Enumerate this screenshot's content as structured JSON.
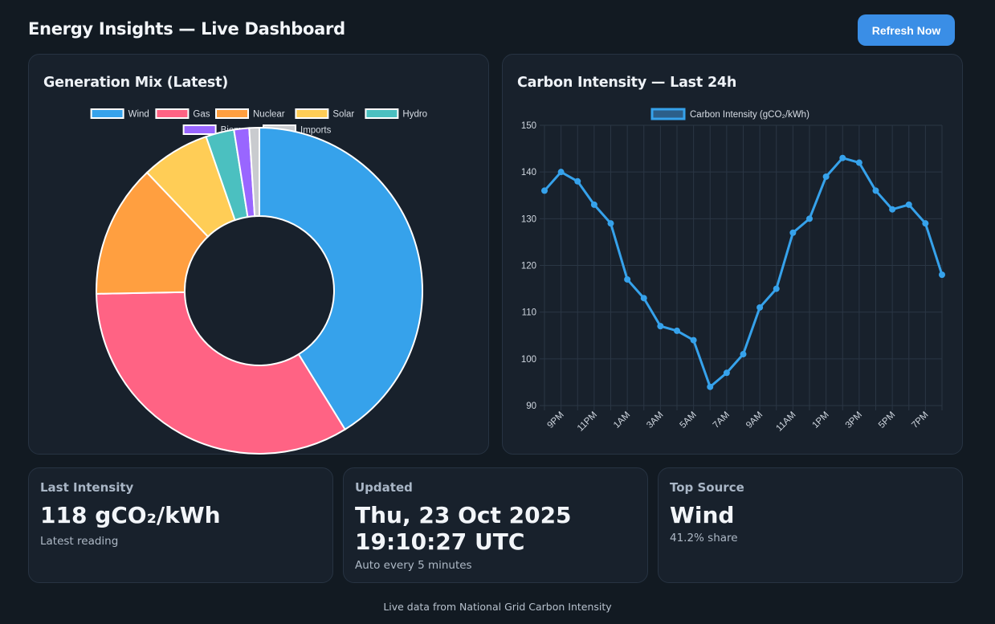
{
  "header": {
    "title": "Energy Insights — Live Dashboard",
    "refresh_label": "Refresh Now"
  },
  "generation_mix": {
    "title": "Generation Mix (Latest)"
  },
  "carbon_intensity": {
    "title": "Carbon Intensity — Last 24h"
  },
  "stats": {
    "last_intensity": {
      "label": "Last Intensity",
      "value": "118 gCO₂/kWh",
      "sub": "Latest reading"
    },
    "updated": {
      "label": "Updated",
      "value_line1": "Thu, 23 Oct 2025",
      "value_line2": "19:10:27 UTC",
      "sub": "Auto every 5 minutes"
    },
    "top_source": {
      "label": "Top Source",
      "value": "Wind",
      "sub": "41.2% share"
    }
  },
  "footer": {
    "text": "Live data from National Grid Carbon Intensity"
  },
  "colors": {
    "accent": "#3a8ee6",
    "line": "#36a2eb",
    "background": "#121a22",
    "card": "#18212c"
  },
  "chart_data": [
    {
      "type": "pie",
      "variant": "doughnut",
      "legend_position": "top",
      "categories": [
        "Wind",
        "Gas",
        "Nuclear",
        "Solar",
        "Hydro",
        "Biomass",
        "Imports"
      ],
      "values": [
        41.2,
        33.5,
        13.2,
        6.8,
        2.8,
        1.5,
        1.0
      ],
      "colors": [
        "#36a2eb",
        "#ff6384",
        "#ff9f40",
        "#ffcd56",
        "#4bc0c0",
        "#9966ff",
        "#c9cbcf"
      ]
    },
    {
      "type": "line",
      "legend_position": "top",
      "grid": true,
      "x": [
        "8PM",
        "9PM",
        "10PM",
        "11PM",
        "12AM",
        "1AM",
        "2AM",
        "3AM",
        "4AM",
        "5AM",
        "6AM",
        "7AM",
        "8AM",
        "9AM",
        "10AM",
        "11AM",
        "12PM",
        "1PM",
        "2PM",
        "3PM",
        "4PM",
        "5PM",
        "6PM",
        "7PM",
        "8PM"
      ],
      "x_tick_labels": [
        "9PM",
        "11PM",
        "1AM",
        "3AM",
        "5AM",
        "7AM",
        "9AM",
        "11AM",
        "1PM",
        "3PM",
        "5PM",
        "7PM"
      ],
      "series": [
        {
          "name": "Carbon Intensity (gCO₂/kWh)",
          "values": [
            136,
            140,
            138,
            133,
            129,
            117,
            113,
            107,
            106,
            104,
            94,
            97,
            101,
            111,
            115,
            127,
            130,
            139,
            143,
            142,
            136,
            132,
            133,
            129,
            118
          ]
        }
      ],
      "ylim": [
        90,
        150
      ],
      "y_ticks": [
        90,
        100,
        110,
        120,
        130,
        140,
        150
      ]
    }
  ]
}
